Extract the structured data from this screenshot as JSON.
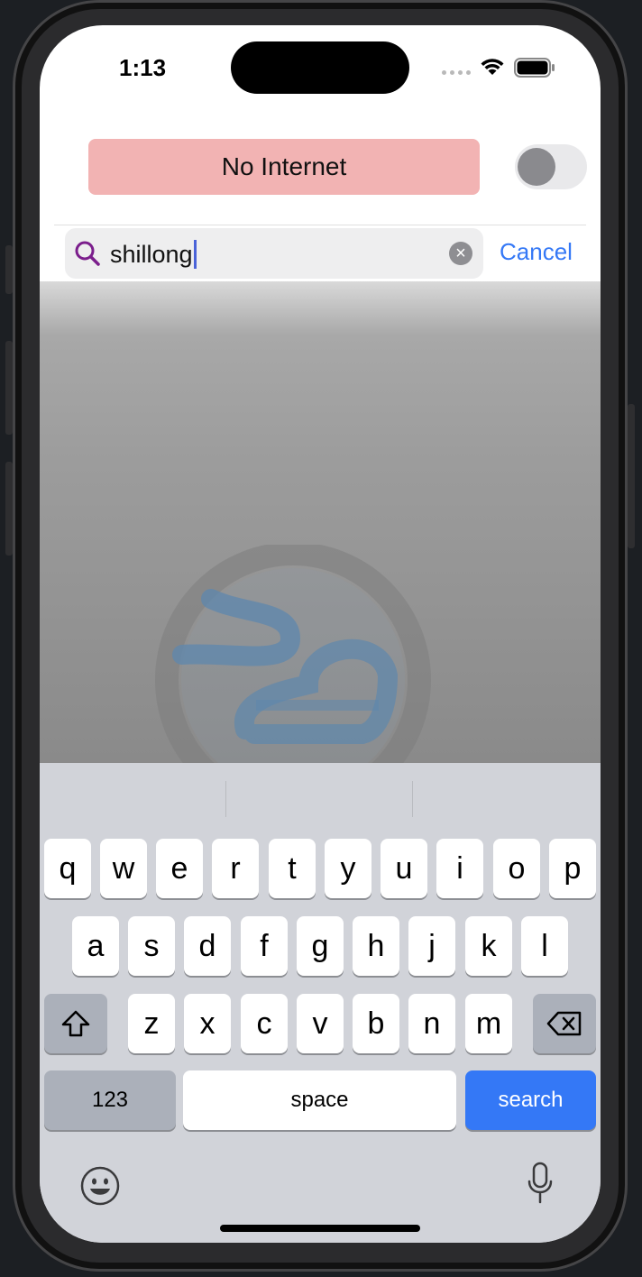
{
  "status_bar": {
    "time": "1:13"
  },
  "banner": {
    "text": "No Internet",
    "color": "#f2b3b3"
  },
  "toggle": {
    "on": false
  },
  "search": {
    "value": "shillong",
    "cancel_label": "Cancel"
  },
  "keyboard": {
    "row1": [
      "q",
      "w",
      "e",
      "r",
      "t",
      "y",
      "u",
      "i",
      "o",
      "p"
    ],
    "row2": [
      "a",
      "s",
      "d",
      "f",
      "g",
      "h",
      "j",
      "k",
      "l"
    ],
    "row3": [
      "z",
      "x",
      "c",
      "v",
      "b",
      "n",
      "m"
    ],
    "numbers_label": "123",
    "space_label": "space",
    "search_label": "search"
  },
  "colors": {
    "accent": "#3478f6",
    "search_icon": "#7b1e8c"
  }
}
